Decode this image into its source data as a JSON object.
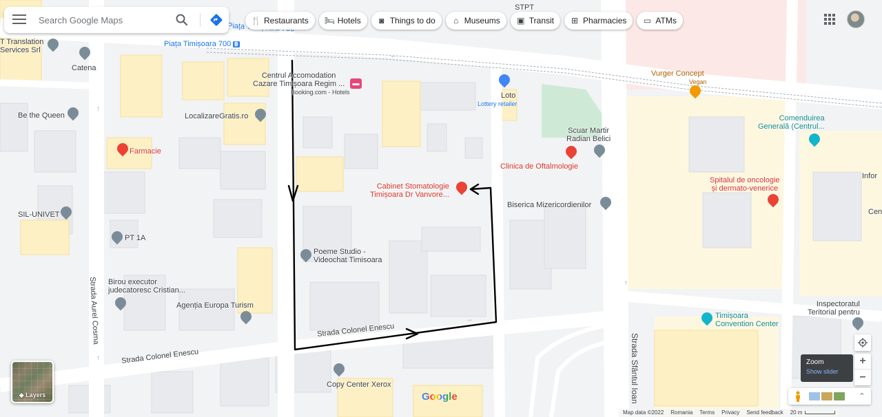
{
  "search": {
    "placeholder": "Search Google Maps",
    "menu_icon": "hamburger-menu-icon",
    "search_icon": "search-icon",
    "directions_icon": "directions-icon"
  },
  "chips": [
    {
      "label": "Restaurants",
      "icon": "restaurant-icon"
    },
    {
      "label": "Hotels",
      "icon": "hotel-icon"
    },
    {
      "label": "Things to do",
      "icon": "camera-icon"
    },
    {
      "label": "Museums",
      "icon": "museum-icon"
    },
    {
      "label": "Transit",
      "icon": "transit-icon"
    },
    {
      "label": "Pharmacies",
      "icon": "pharmacy-icon"
    },
    {
      "label": "ATMs",
      "icon": "atm-icon"
    }
  ],
  "places": {
    "translation": "T Translation\nServices Srl",
    "catena": "Catena",
    "be_the_queen": "Be the Queen",
    "localizare": "LocalizareGratis.ro",
    "farmacie": "Farmacie",
    "sil_univet": "SIL-UNIVET",
    "pt1a": "PT 1A",
    "birou": "Birou executor\njudecatoresc Cristian...",
    "agentia": "Agenția Europa Turism",
    "hotel_name": "Centrul Accomodation\nCazare Timișoara Regim ...",
    "hotel_sub": "Booking.com - Hotels",
    "loto": "Loto",
    "loto_sub": "Lottery retailer",
    "scuar": "Scuar Martir\nRadian Belici",
    "clinica": "Clinica de Oftalmologie",
    "cabinet": "Cabinet Stomatologie\nTimișoara Dr Vanvore...",
    "biserica": "Biserica Mizericordienilor",
    "poeme": "Poeme Studio -\nVideochat Timisoara",
    "copy_center": "Copy Center Xerox",
    "vurger": "Vurger Concept",
    "vegan": "Vegan",
    "comenduirea": "Comenduirea\nGenerală (Centrul...",
    "spitalul": "Spitalul de oncologie\nși dermato-venerice",
    "infor": "Infor",
    "cen": "Cen",
    "convention": "Timișoara\nConvention Center",
    "inspectoratul": "Inspectoratul\nTeritorial pentru",
    "stpt": "STPT"
  },
  "streets": {
    "piata_top": "Piața Timișoara 700",
    "piata_main": "Piața Timișoara 700",
    "piata_badge": "B",
    "colonel_enescu_1": "Strada Colonel Enescu",
    "colonel_enescu_2": "Strada Colonel Enescu",
    "aurel_cosma": "Strada Aurel Cosma",
    "sfantul_ioan": "Strada Sfântul Ioan"
  },
  "controls": {
    "layers_label": "Layers",
    "zoom_title": "Zoom",
    "zoom_link": "Show slider",
    "zoom_in": "+",
    "zoom_out": "−",
    "expand": "⌃"
  },
  "footer": {
    "map_data": "Map data ©2022",
    "romania": "Romania",
    "terms": "Terms",
    "privacy": "Privacy",
    "feedback": "Send feedback",
    "scale": "20 m"
  },
  "logo": "Google",
  "colors": {
    "accent_blue": "#1a73e8",
    "poi_gray": "#7b8c99",
    "poi_red": "#ea4335",
    "poi_orange": "#f29900",
    "poi_teal": "#12b5cb",
    "route_black": "#000000"
  }
}
